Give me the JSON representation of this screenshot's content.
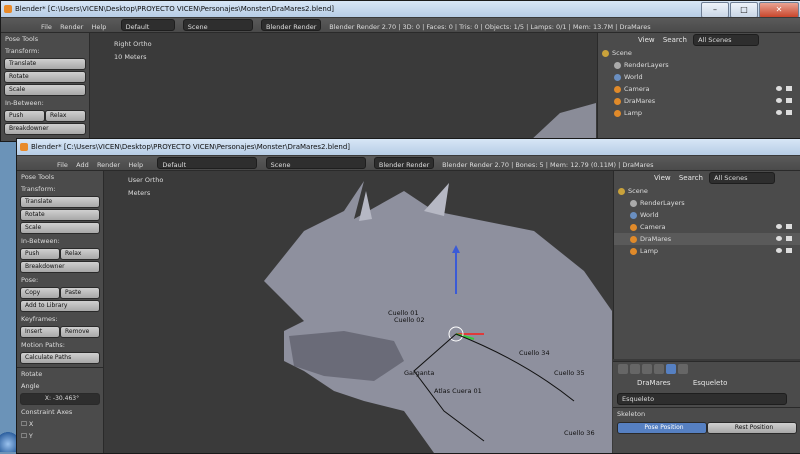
{
  "back_window": {
    "title": "Blender* [C:\\Users\\VICEN\\Desktop\\PROYECTO VICEN\\Personajes\\Monster\\DraMares2.blend]",
    "menus": [
      "File",
      "Render",
      "Help"
    ],
    "layout": "Default",
    "scene": "Scene",
    "engine": "Blender Render",
    "info": "Blender Render 2.70 | 3D: 0 | Faces: 0 | Tris: 0 | Objects: 1/5 | Lamps: 0/1 | Mem: 13.7M | DraMares",
    "toolshelf": {
      "header": "Pose Tools",
      "transform_label": "Transform:",
      "translate": "Translate",
      "rotate": "Rotate",
      "scale": "Scale",
      "in_between_label": "In-Between:",
      "push": "Push",
      "relax": "Relax",
      "breakdowner": "Breakdowner"
    },
    "viewport": {
      "view_label": "Right Ortho",
      "units": "10 Meters"
    },
    "outliner": {
      "header_buttons": [
        "View",
        "Search"
      ],
      "filter": "All Scenes",
      "rows": [
        "Scene",
        "RenderLayers",
        "World",
        "Camera",
        "DraMares",
        "Lamp"
      ]
    }
  },
  "front_window": {
    "title": "Blender* [C:\\Users\\VICEN\\Desktop\\PROYECTO VICEN\\Personajes\\Monster\\DraMares2.blend]",
    "menus": [
      "File",
      "Add",
      "Render",
      "Help"
    ],
    "layout": "Default",
    "scene": "Scene",
    "engine": "Blender Render",
    "info": "Blender Render 2.70 | Bones: 5 | Mem: 12.79 (0.11M) | DraMares",
    "window_buttons": {
      "minimize": "–",
      "maximize": "□",
      "close": "✕"
    },
    "toolshelf": {
      "header": "Pose Tools",
      "transform_label": "Transform:",
      "translate": "Translate",
      "rotate": "Rotate",
      "scale": "Scale",
      "in_between_label": "In-Between:",
      "push": "Push",
      "relax": "Relax",
      "breakdowner": "Breakdowner",
      "pose_label": "Pose:",
      "copy": "Copy",
      "paste": "Paste",
      "add_to_library": "Add to Library",
      "keyframes_label": "Keyframes:",
      "insert": "Insert",
      "remove": "Remove",
      "motion_paths_label": "Motion Paths:",
      "calculate_paths": "Calculate Paths",
      "rotate_panel": "Rotate",
      "angle_label": "Angle",
      "angle_value": "X: -30.463°",
      "constraint_axes": "Constraint Axes",
      "axis_x": "X",
      "axis_y": "Y"
    },
    "viewport": {
      "view_label": "User Ortho",
      "units": "Meters",
      "bone_labels": [
        "Cuello 01",
        "Cuello 02",
        "Garganta",
        "Atlas Cuera 01",
        "Cuello 34",
        "Cuello 35",
        "Cuello 36"
      ]
    },
    "outliner": {
      "header_buttons": [
        "View",
        "Search"
      ],
      "filter": "All Scenes",
      "rows": [
        "Scene",
        "RenderLayers",
        "World",
        "Camera",
        "DraMares",
        "Lamp"
      ]
    },
    "properties": {
      "object_name": "DraMares",
      "armature_name": "Esqueleto",
      "data_field": "Esqueleto",
      "panel": "Skeleton",
      "pose_position": "Pose Position",
      "rest_position": "Rest Position"
    }
  },
  "colors": {
    "viewport_bg": "#3a3a3a",
    "panel_bg": "#4b4b4b",
    "desktop": "#6b93b8",
    "accent": "#5680c2"
  }
}
